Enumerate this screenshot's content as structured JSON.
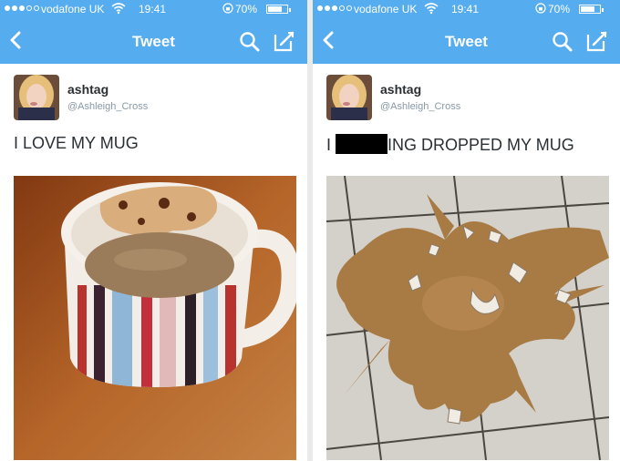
{
  "colors": {
    "accent": "#55acee",
    "text": "#292f33",
    "secondary": "#8899a6"
  },
  "panels": [
    {
      "status": {
        "carrier": "vodafone UK",
        "time": "19:41",
        "battery": "70%",
        "battery_level": 0.7
      },
      "nav": {
        "title": "Tweet",
        "back_icon": "chevron-left-icon",
        "search_icon": "search-icon",
        "compose_icon": "compose-icon"
      },
      "tweet": {
        "name": "ashtag",
        "handle": "@Ashleigh_Cross",
        "text": "I LOVE MY MUG",
        "photo": "coffee mug"
      }
    },
    {
      "status": {
        "carrier": "vodafone UK",
        "time": "19:41",
        "battery": "70%",
        "battery_level": 0.7
      },
      "nav": {
        "title": "Tweet",
        "back_icon": "chevron-left-icon",
        "search_icon": "search-icon",
        "compose_icon": "compose-icon"
      },
      "tweet": {
        "name": "ashtag",
        "handle": "@Ashleigh_Cross",
        "text_before": "I",
        "text_after": "ING DROPPED MY MUG",
        "photo": "spilled coffee"
      }
    }
  ]
}
